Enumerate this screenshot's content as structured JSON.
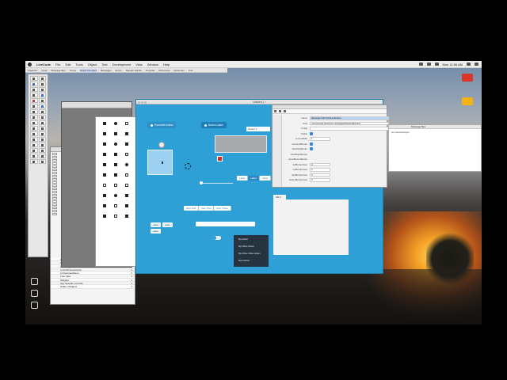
{
  "menubar": {
    "app": "LiveCode",
    "items": [
      "File",
      "Edit",
      "Tools",
      "Object",
      "Text",
      "Development",
      "View",
      "Window",
      "Help"
    ],
    "clock": "Mon 11:56 AM"
  },
  "toolbar": {
    "items": [
      "Inspector",
      "Code",
      "Message Box",
      "Group",
      "Select Grouped",
      "Messages",
      "Errors",
      "Sample Stacks",
      "Tutorials",
      "Resources",
      "Dictionary",
      "Test"
    ]
  },
  "desktop": {
    "icons": [
      {
        "label": "",
        "color": "#d9352a"
      },
      {
        "label": "",
        "color": "#f2b30f"
      }
    ]
  },
  "project_browser": {
    "rows": [
      {
        "name": "Data Grid Templates 1473417716594",
        "count": "1"
      },
      {
        "name": "LCDataGrid",
        "count": "1"
      },
      {
        "name": "LCCWidgets",
        "count": "1"
      },
      {
        "name": "LCLCPComponents",
        "count": "1"
      },
      {
        "name": "LCUseCaseMenu",
        "count": "1"
      },
      {
        "name": "Tree View",
        "count": "1"
      },
      {
        "name": "Widgets",
        "count": "1"
      },
      {
        "name": "App Specific Controls",
        "count": "1"
      },
      {
        "name": "Hidden Widgets",
        "count": "1"
      }
    ]
  },
  "widgets_window": {
    "title": "Untitled 1 *",
    "button1": "Rounded button",
    "button2": "Button Label",
    "combo": "Option 1",
    "seg_a": [
      "Label",
      "Label",
      "Label"
    ],
    "seg_b": [
      "Item One",
      "Item Two",
      "Item Three"
    ],
    "tags": [
      "Label",
      "Label",
      "Label"
    ],
    "menu": [
      "My Action",
      "My Other Action",
      "My Other Other Action",
      "New Action"
    ],
    "tab": "Tab 1"
  },
  "inspector": {
    "rows": [
      {
        "k": "Name",
        "v": "Rectangle With Optional Borders"
      },
      {
        "k": "Kind",
        "v": "com.livecode.extensions.rectanglewithoptionalborders"
      },
      {
        "k": "Tooltip",
        "v": ""
      },
      {
        "k": "Visible",
        "v": ""
      },
      {
        "k": "cornerWidth",
        "v": "0"
      },
      {
        "k": "showLeftBorder",
        "v": ""
      },
      {
        "k": "showTopBorder",
        "v": ""
      },
      {
        "k": "showRightBorder",
        "v": ""
      },
      {
        "k": "showBottomBorder",
        "v": ""
      },
      {
        "k": "leftBorderInset",
        "v": "0"
      },
      {
        "k": "topBorderInset",
        "v": "0"
      },
      {
        "k": "rightBorderInset",
        "v": "0"
      },
      {
        "k": "bottomBorderInset",
        "v": "0"
      }
    ]
  },
  "message_box": {
    "title": "Message Box",
    "line": "put selectedobject"
  }
}
